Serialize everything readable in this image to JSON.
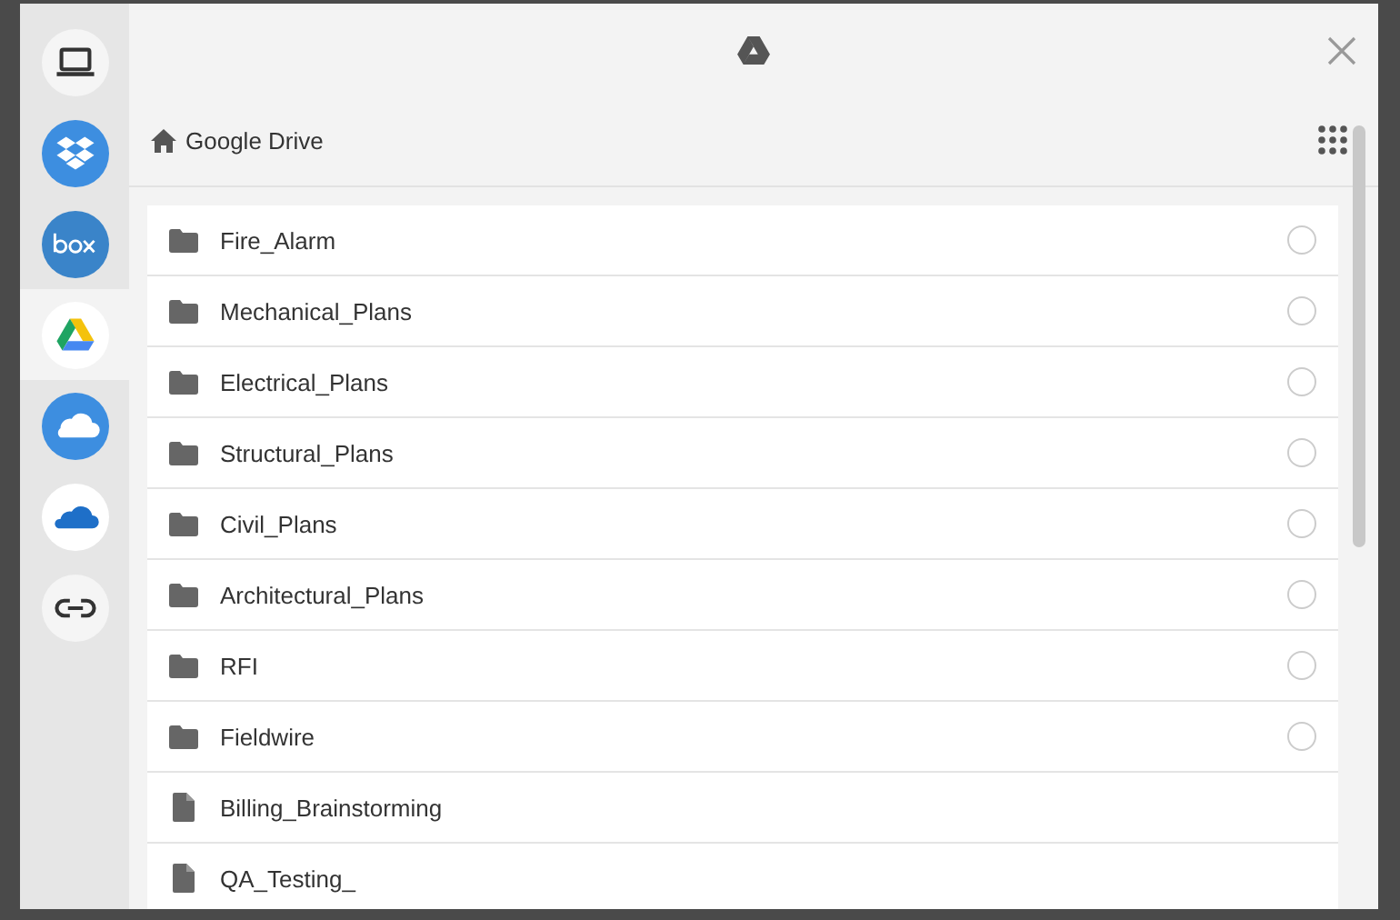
{
  "sidebar": {
    "items": [
      {
        "kind": "computer",
        "selected": false
      },
      {
        "kind": "dropbox",
        "selected": false
      },
      {
        "kind": "box",
        "selected": false
      },
      {
        "kind": "drive",
        "selected": true
      },
      {
        "kind": "cloud",
        "selected": false
      },
      {
        "kind": "onedrive",
        "selected": false
      },
      {
        "kind": "link",
        "selected": false
      }
    ]
  },
  "breadcrumb": "Google Drive",
  "files": [
    {
      "kind": "folder",
      "name": "Fire_Alarm",
      "selected": false
    },
    {
      "kind": "folder",
      "name": "Mechanical_Plans",
      "selected": false
    },
    {
      "kind": "folder",
      "name": "Electrical_Plans",
      "selected": false
    },
    {
      "kind": "folder",
      "name": "Structural_Plans",
      "selected": false
    },
    {
      "kind": "folder",
      "name": "Civil_Plans",
      "selected": false
    },
    {
      "kind": "folder",
      "name": "Architectural_Plans",
      "selected": false
    },
    {
      "kind": "folder",
      "name": "RFI",
      "selected": false
    },
    {
      "kind": "folder",
      "name": "Fieldwire",
      "selected": false
    },
    {
      "kind": "file",
      "name": "Billing_Brainstorming"
    },
    {
      "kind": "file",
      "name": "QA_Testing_"
    }
  ]
}
